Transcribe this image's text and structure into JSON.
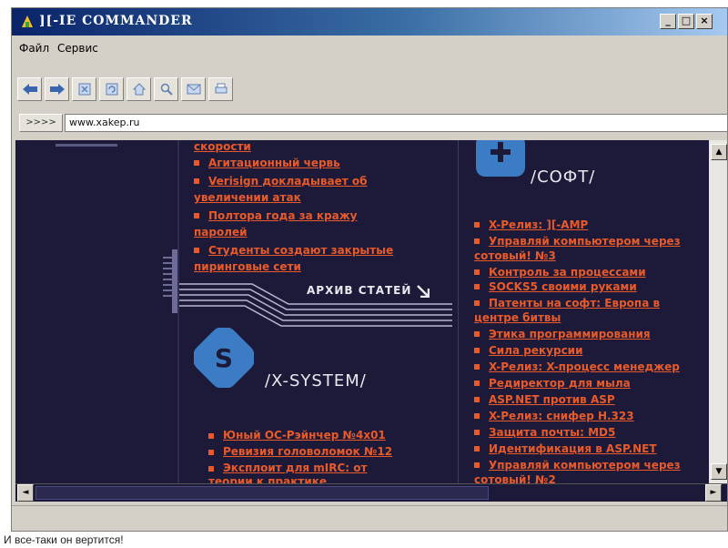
{
  "window": {
    "title": "][-IE COMMANDER",
    "minimize_label": "_",
    "maximize_label": "□",
    "close_label": "×"
  },
  "menu": [
    {
      "label": "Файл"
    },
    {
      "label": "Сервис"
    }
  ],
  "address": {
    "go_label": ">>>>",
    "url": "www.xakep.ru"
  },
  "left_column": {
    "links": [
      {
        "lines": [
          "скорости"
        ],
        "bullet": false
      },
      {
        "lines": [
          "Агитационный червь"
        ],
        "bullet": true
      },
      {
        "lines": [
          "Verisign докладывает об",
          "увеличении атак"
        ],
        "bullet": true
      },
      {
        "lines": [
          "Полтора года за кражу",
          "паролей"
        ],
        "bullet": true
      },
      {
        "lines": [
          "Студенты создают закрытые",
          "пиринговые сети"
        ],
        "bullet": true
      }
    ],
    "archive_label": "АРХИВ СТАТЕЙ",
    "section_title": "/X-SYSTEM/",
    "section_links": [
      {
        "lines": [
          "Юный ОС-Рэйнчер №4х01"
        ]
      },
      {
        "lines": [
          "Ревизия головоломок №12"
        ]
      },
      {
        "lines": [
          "Эксплоит для mIRC: от",
          "теории к практике"
        ]
      }
    ]
  },
  "right_column": {
    "section_title": "/СОФТ/",
    "links": [
      {
        "lines": [
          "X-Релиз: ][-AMP"
        ]
      },
      {
        "lines": [
          "Управляй компьютером через",
          "сотовый! №3"
        ]
      },
      {
        "lines": [
          "Контроль за процессами"
        ]
      },
      {
        "lines": [
          "SOCKS5 своими руками"
        ]
      },
      {
        "lines": [
          "Патенты на софт: Европа в",
          "центре битвы"
        ]
      },
      {
        "lines": [
          "Этика программирования"
        ]
      },
      {
        "lines": [
          "Сила рекурсии"
        ]
      },
      {
        "lines": [
          "X-Релиз: X-процесс менеджер"
        ]
      },
      {
        "lines": [
          "Редиректор для мыла"
        ]
      },
      {
        "lines": [
          "ASP.NET против ASP"
        ]
      },
      {
        "lines": [
          "X-Релиз: снифер H.323"
        ]
      },
      {
        "lines": [
          "Защита почты: MD5"
        ]
      },
      {
        "lines": [
          "Идентификация в ASP.NET"
        ]
      },
      {
        "lines": [
          "Управляй компьютером через",
          "сотовый! №2"
        ]
      }
    ]
  },
  "scrollbar": {
    "up_label": "▲",
    "down_label": "▼",
    "left_label": "◄",
    "right_label": "►"
  },
  "caption": "И все-таки он вертится!",
  "colors": {
    "titlebar_start": "#0a246a",
    "content_bg": "#1c1a38",
    "link": "#e85a2a",
    "logo_blue": "#3b7cc4"
  }
}
